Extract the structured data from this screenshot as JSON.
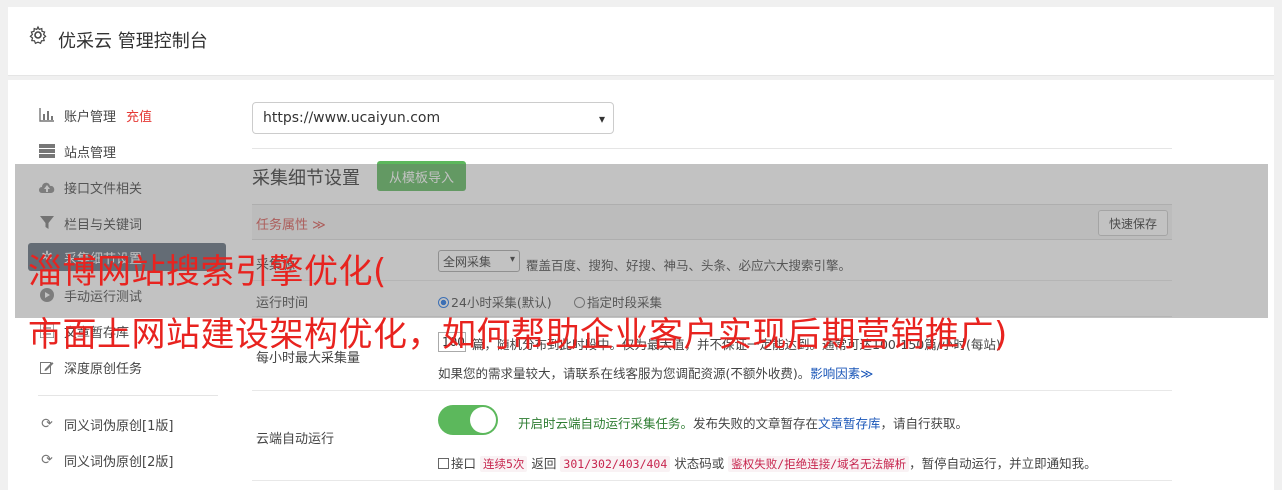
{
  "header": {
    "title": "优采云 管理控制台",
    "icon": "gear-icon"
  },
  "sidebar": {
    "items": [
      {
        "label": "账户管理",
        "extra": "充值",
        "icon": "bar-chart-icon"
      },
      {
        "label": "站点管理",
        "icon": "server-icon"
      },
      {
        "label": "接口文件相关",
        "icon": "cloud-upload-icon"
      },
      {
        "label": "栏目与关键词",
        "icon": "filter-icon"
      },
      {
        "label": "采集细节设置",
        "icon": "gear-icon",
        "active": true
      },
      {
        "label": "手动运行测试",
        "icon": "play-icon"
      },
      {
        "label": "文章暂存库",
        "icon": "list-icon"
      },
      {
        "label": "深度原创任务",
        "icon": "edit-icon"
      },
      {
        "label": "同义词伪原创[1版]",
        "icon": "refresh-icon"
      },
      {
        "label": "同义词伪原创[2版]",
        "icon": "refresh-icon"
      }
    ]
  },
  "site_select": {
    "value": "https://www.ucaiyun.com"
  },
  "section": {
    "title": "采集细节设置",
    "template_button": "从模板导入",
    "attr_label": "任务属性 ≫",
    "save_button": "快速保存"
  },
  "rows": {
    "source": {
      "label": "采集源",
      "select_value": "全网采集",
      "desc": "覆盖百度、搜狗、好搜、神马、头条、必应六大搜索引擎。"
    },
    "runtime": {
      "label": "运行时间",
      "option1": "24小时采集(默认)",
      "option2": "指定时段采集"
    },
    "max_per_hour": {
      "label": "每小时最大采集量",
      "value": "100",
      "desc": "篇，随机分布到此时段中。仅为最大值，并不保证一定能达到。通常可达100-150篇/小时(每站)",
      "note": "如果您的需求量较大，请联系在线客服为您调配资源(不额外收费)。",
      "note_link": "影响因素≫"
    },
    "cloud": {
      "label": "云端自动运行",
      "toggle_on": true,
      "desc_green": "开启时云端自动运行采集任务。",
      "desc_1": "发布失败的文章暂存在",
      "desc_link": "文章暂存库",
      "desc_2": "，请自行获取。",
      "check_label": "接口",
      "c1": "连续5次",
      "t1": "返回",
      "c2": "301/302/403/404",
      "t2": "状态码或",
      "c3": "鉴权失败/拒绝连接/域名无法解析",
      "t3": "，暂停自动运行，并立即通知我。"
    }
  },
  "overlay": {
    "line1": "淄博网站搜索引擎优化(",
    "line2": "市面上网站建设架构优化，如何帮助企业客户实现后期营销推广)"
  }
}
